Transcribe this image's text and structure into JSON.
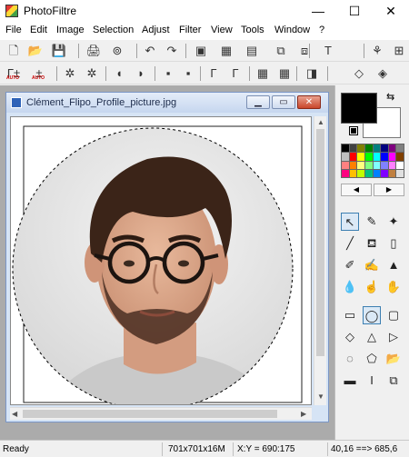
{
  "window": {
    "title": "PhotoFiltre",
    "minimize_glyph": "—",
    "maximize_glyph": "☐",
    "close_glyph": "✕"
  },
  "menu": [
    "File",
    "Edit",
    "Image",
    "Selection",
    "Adjust",
    "Filter",
    "View",
    "Tools",
    "Window",
    "?"
  ],
  "toolbar1": {
    "icons": [
      "new-icon",
      "open-icon",
      "save-icon",
      "print-icon",
      "scan-icon",
      "undo-icon",
      "redo-icon",
      "transparency-icon",
      "palette-icon",
      "color-icon",
      "mask-icon",
      "crop-icon",
      "text-icon",
      "filter-icon",
      "automation-icon"
    ],
    "glyphs": [
      "🗋",
      "📂",
      "💾",
      "🖨",
      "⊚",
      "↶",
      "↷",
      "▣",
      "▦",
      "▤",
      "⧉",
      "⧈",
      "T",
      "⚘",
      "⊞"
    ]
  },
  "toolbar2": {
    "auto_levels_label": "AUTO",
    "auto_contrast_label": "AUTO",
    "icons": [
      "auto-levels-icon",
      "auto-contrast-icon",
      "brightness-minus-icon",
      "brightness-plus-icon",
      "contrast-minus-icon",
      "contrast-plus-icon",
      "saturation-minus-icon",
      "saturation-plus-icon",
      "gamma-minus-icon",
      "gamma-plus-icon",
      "sharpen-icon",
      "blur-icon",
      "effect-icon",
      "drop-icon",
      "drop-outline-icon"
    ],
    "glyphs": [
      "Γ±",
      "±",
      "✲",
      "✲",
      "◖",
      "◗",
      "▪",
      "▪",
      "Γ",
      "Γ",
      "▦",
      "▦",
      "◨",
      "◇",
      "◈"
    ]
  },
  "document": {
    "title": "Clément_Flipo_Profile_picture.jpg",
    "min_glyph": "▁",
    "max_glyph": "▭",
    "close_glyph": "✕",
    "up_arrow": "▲",
    "down_arrow": "▼",
    "left_arrow": "◀",
    "right_arrow": "▶"
  },
  "colors": {
    "foreground": "#000000",
    "background": "#ffffff",
    "palette": [
      "#000000",
      "#404040",
      "#808000",
      "#008000",
      "#008080",
      "#000080",
      "#800080",
      "#808080",
      "#c0c0c0",
      "#ff0000",
      "#ffff00",
      "#00ff00",
      "#00ffff",
      "#0000ff",
      "#ff00ff",
      "#804000",
      "#ff8080",
      "#ff8000",
      "#ffff80",
      "#80ff80",
      "#80ffff",
      "#8080ff",
      "#ff80ff",
      "#ffffff",
      "#ff0080",
      "#ffc000",
      "#c0ff00",
      "#00c080",
      "#0080ff",
      "#8000ff",
      "#c08040",
      "#e0e0e0"
    ],
    "swap_glyph": "⇆",
    "prev_glyph": "◀",
    "next_glyph": "▶"
  },
  "tools": [
    {
      "name": "selection-tool-icon",
      "glyph": "↖",
      "active": true
    },
    {
      "name": "eyedropper-tool-icon",
      "glyph": "✎",
      "active": false
    },
    {
      "name": "magic-wand-tool-icon",
      "glyph": "✦",
      "active": false
    },
    {
      "name": "line-tool-icon",
      "glyph": "╱",
      "active": false
    },
    {
      "name": "fill-tool-icon",
      "glyph": "⛾",
      "active": false
    },
    {
      "name": "spray-tool-icon",
      "glyph": "▯",
      "active": false
    },
    {
      "name": "brush-tool-icon",
      "glyph": "✐",
      "active": false
    },
    {
      "name": "advanced-brush-tool-icon",
      "glyph": "✍",
      "active": false
    },
    {
      "name": "stamp-tool-icon",
      "glyph": "▲",
      "active": false
    },
    {
      "name": "blur-drop-tool-icon",
      "glyph": "💧",
      "active": false
    },
    {
      "name": "smudge-tool-icon",
      "glyph": "☝",
      "active": false
    },
    {
      "name": "hand-tool-icon",
      "glyph": "✋",
      "active": false
    }
  ],
  "shapes": [
    {
      "name": "rectangle-shape-icon",
      "glyph": "▭",
      "active": false
    },
    {
      "name": "ellipse-shape-icon",
      "glyph": "◯",
      "active": true
    },
    {
      "name": "rounded-rect-shape-icon",
      "glyph": "▢",
      "active": false
    },
    {
      "name": "diamond-shape-icon",
      "glyph": "◇",
      "active": false
    },
    {
      "name": "triangle-shape-icon",
      "glyph": "△",
      "active": false
    },
    {
      "name": "triangle-right-shape-icon",
      "glyph": "▷",
      "active": false
    },
    {
      "name": "lasso-shape-icon",
      "glyph": "◌",
      "active": false
    },
    {
      "name": "polygon-shape-icon",
      "glyph": "⬠",
      "active": false
    },
    {
      "name": "open-selection-icon",
      "glyph": "📂",
      "active": false
    },
    {
      "name": "select-all-icon",
      "glyph": "▬",
      "active": false
    },
    {
      "name": "text-select-icon",
      "glyph": "I",
      "active": false
    },
    {
      "name": "copy-selection-icon",
      "glyph": "⧉",
      "active": false
    }
  ],
  "status": {
    "ready": "Ready",
    "size": "701x701x16M",
    "coords": "X:Y = 690:175",
    "zoom": "40,16 ==> 685,6"
  }
}
